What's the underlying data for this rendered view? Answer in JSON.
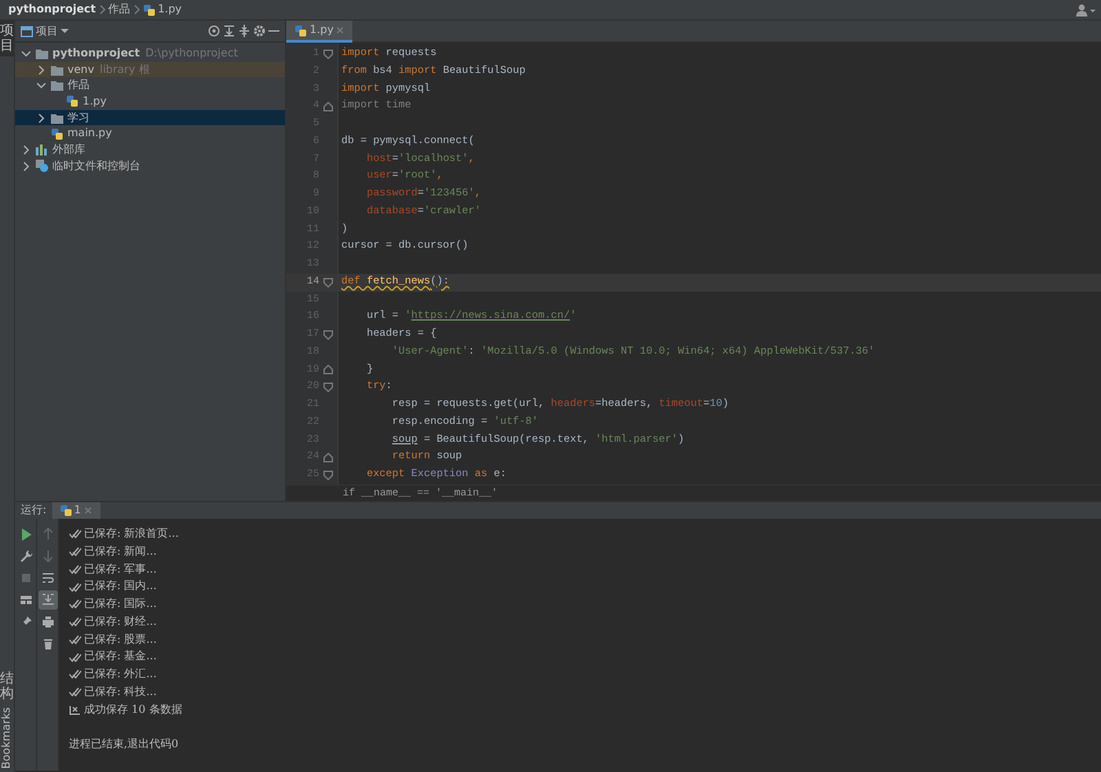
{
  "breadcrumb": [
    {
      "label": "pythonproject",
      "kind": "project"
    },
    {
      "label": "作品",
      "kind": "folder"
    },
    {
      "label": "1.py",
      "kind": "file"
    }
  ],
  "left_stripe": {
    "top_tabs": [
      {
        "label": "项目",
        "selected": true
      }
    ],
    "bottom_tabs": [
      {
        "label": "结构",
        "kind": "cjk"
      },
      {
        "label": "Bookmarks",
        "kind": "latin"
      }
    ]
  },
  "project_panel": {
    "title": "项目",
    "tree": [
      {
        "label": "pythonproject",
        "note": "D:\\pythonproject",
        "kind": "project",
        "expanded": true,
        "selected": false,
        "highlighted": false,
        "children": [
          {
            "label": "venv",
            "note": "library 根",
            "kind": "folder",
            "expanded": false,
            "selected": false,
            "highlighted": true
          },
          {
            "label": "作品",
            "kind": "folder",
            "expanded": true,
            "selected": false,
            "highlighted": false,
            "children": [
              {
                "label": "1.py",
                "kind": "file",
                "selected": false,
                "highlighted": false
              }
            ]
          },
          {
            "label": "学习",
            "kind": "folder",
            "expanded": false,
            "selected": true,
            "highlighted": false
          },
          {
            "label": "main.py",
            "kind": "file",
            "selected": false,
            "highlighted": false
          }
        ]
      },
      {
        "label": "外部库",
        "kind": "library",
        "expanded": false,
        "selected": false,
        "highlighted": false
      },
      {
        "label": "临时文件和控制台",
        "kind": "scratch",
        "expanded": false,
        "selected": false,
        "highlighted": false
      }
    ]
  },
  "editor": {
    "tabs": [
      {
        "label": "1.py",
        "selected": true
      }
    ],
    "lines": [
      {
        "number": "1",
        "fold_start": true,
        "fold_end": false,
        "current": false,
        "warning": false,
        "tokens": [
          {
            "text": "import",
            "kind": "kw"
          },
          {
            "text": " requests",
            "kind": "id"
          }
        ]
      },
      {
        "number": "2",
        "fold_start": false,
        "fold_end": false,
        "current": false,
        "warning": false,
        "tokens": [
          {
            "text": "from",
            "kind": "kw"
          },
          {
            "text": " bs4 ",
            "kind": "id"
          },
          {
            "text": "import",
            "kind": "kw"
          },
          {
            "text": " BeautifulSoup",
            "kind": "id"
          }
        ]
      },
      {
        "number": "3",
        "fold_start": false,
        "fold_end": false,
        "current": false,
        "warning": false,
        "tokens": [
          {
            "text": "import",
            "kind": "kw"
          },
          {
            "text": " pymysql",
            "kind": "id"
          }
        ]
      },
      {
        "number": "4",
        "fold_start": false,
        "fold_end": true,
        "current": false,
        "warning": false,
        "tokens": [
          {
            "text": "import time",
            "kind": "unused"
          }
        ]
      },
      {
        "number": "5",
        "fold_start": false,
        "fold_end": false,
        "current": false
      },
      {
        "number": "6",
        "fold_start": false,
        "fold_end": false,
        "current": false,
        "warning": false,
        "tokens": [
          {
            "text": "db = pymysql.connect(",
            "kind": "id"
          }
        ]
      },
      {
        "number": "7",
        "fold_start": false,
        "fold_end": false,
        "current": false,
        "warning": false,
        "tokens": [
          {
            "text": "    host",
            "kind": "param"
          },
          {
            "text": "=",
            "kind": "id"
          },
          {
            "text": "'localhost'",
            "kind": "str"
          },
          {
            "text": ",",
            "kind": "kw"
          }
        ]
      },
      {
        "number": "8",
        "fold_start": false,
        "fold_end": false,
        "current": false,
        "warning": false,
        "tokens": [
          {
            "text": "    user",
            "kind": "param"
          },
          {
            "text": "=",
            "kind": "id"
          },
          {
            "text": "'root'",
            "kind": "str"
          },
          {
            "text": ",",
            "kind": "kw"
          }
        ]
      },
      {
        "number": "9",
        "fold_start": false,
        "fold_end": false,
        "current": false,
        "warning": false,
        "tokens": [
          {
            "text": "    password",
            "kind": "param"
          },
          {
            "text": "=",
            "kind": "id"
          },
          {
            "text": "'123456'",
            "kind": "str"
          },
          {
            "text": ",",
            "kind": "kw"
          }
        ]
      },
      {
        "number": "10",
        "fold_start": false,
        "fold_end": false,
        "current": false,
        "warning": false,
        "tokens": [
          {
            "text": "    database",
            "kind": "param"
          },
          {
            "text": "=",
            "kind": "id"
          },
          {
            "text": "'crawler'",
            "kind": "str"
          }
        ]
      },
      {
        "number": "11",
        "fold_start": false,
        "fold_end": false,
        "current": false,
        "warning": false,
        "tokens": [
          {
            "text": ")",
            "kind": "id"
          }
        ]
      },
      {
        "number": "12",
        "fold_start": false,
        "fold_end": false,
        "current": false,
        "warning": false,
        "tokens": [
          {
            "text": "cursor = db.cursor()",
            "kind": "id"
          }
        ]
      },
      {
        "number": "13",
        "fold_start": false,
        "fold_end": false,
        "current": false
      },
      {
        "number": "14",
        "fold_start": true,
        "fold_end": false,
        "current": true,
        "warning": true,
        "tokens": [
          {
            "text": "def",
            "kind": "kw"
          },
          {
            "text": " fetch_news",
            "kind": "fn"
          },
          {
            "text": "():",
            "kind": "id"
          }
        ]
      },
      {
        "number": "15",
        "fold_start": false,
        "fold_end": false,
        "current": false
      },
      {
        "number": "16",
        "fold_start": false,
        "fold_end": false,
        "current": false,
        "warning": false,
        "tokens": [
          {
            "text": "    url = ",
            "kind": "id"
          },
          {
            "text": "'",
            "kind": "str"
          },
          {
            "text": "https://news.sina.com.cn/",
            "kind": "link"
          },
          {
            "text": "'",
            "kind": "str"
          }
        ]
      },
      {
        "number": "17",
        "fold_start": true,
        "fold_end": false,
        "current": false,
        "warning": false,
        "tokens": [
          {
            "text": "    headers = {",
            "kind": "id"
          }
        ]
      },
      {
        "number": "18",
        "fold_start": false,
        "fold_end": false,
        "current": false,
        "warning": false,
        "tokens": [
          {
            "text": "        'User-Agent'",
            "kind": "str"
          },
          {
            "text": ": ",
            "kind": "id"
          },
          {
            "text": "'Mozilla/5.0 (Windows NT 10.0; Win64; x64) AppleWebKit/537.36'",
            "kind": "str"
          }
        ]
      },
      {
        "number": "19",
        "fold_start": false,
        "fold_end": true,
        "current": false,
        "warning": false,
        "tokens": [
          {
            "text": "    }",
            "kind": "id"
          }
        ]
      },
      {
        "number": "20",
        "fold_start": true,
        "fold_end": false,
        "current": false,
        "warning": false,
        "tokens": [
          {
            "text": "    try",
            "kind": "kw"
          },
          {
            "text": ":",
            "kind": "id"
          }
        ]
      },
      {
        "number": "21",
        "fold_start": false,
        "fold_end": false,
        "current": false,
        "warning": false,
        "tokens": [
          {
            "text": "        resp = requests.get(url, ",
            "kind": "id"
          },
          {
            "text": "headers",
            "kind": "param"
          },
          {
            "text": "=headers, ",
            "kind": "id"
          },
          {
            "text": "timeout",
            "kind": "param"
          },
          {
            "text": "=",
            "kind": "id"
          },
          {
            "text": "10",
            "kind": "num"
          },
          {
            "text": ")",
            "kind": "id"
          }
        ]
      },
      {
        "number": "22",
        "fold_start": false,
        "fold_end": false,
        "current": false,
        "warning": false,
        "tokens": [
          {
            "text": "        resp.encoding = ",
            "kind": "id"
          },
          {
            "text": "'utf-8'",
            "kind": "str"
          }
        ]
      },
      {
        "number": "23",
        "fold_start": false,
        "fold_end": false,
        "current": false,
        "warning": false,
        "tokens": [
          {
            "text": "        soup",
            "kind": "underlined"
          },
          {
            "text": " = BeautifulSoup(resp.text, ",
            "kind": "id"
          },
          {
            "text": "'html.parser'",
            "kind": "str"
          },
          {
            "text": ")",
            "kind": "id"
          }
        ]
      },
      {
        "number": "24",
        "fold_start": false,
        "fold_end": true,
        "current": false,
        "warning": false,
        "tokens": [
          {
            "text": "        return",
            "kind": "kw"
          },
          {
            "text": " soup",
            "kind": "id"
          }
        ]
      },
      {
        "number": "25",
        "fold_start": true,
        "fold_end": false,
        "current": false,
        "warning": false,
        "tokens": [
          {
            "text": "    except",
            "kind": "kw"
          },
          {
            "text": " Exception",
            "kind": "builtin"
          },
          {
            "text": " as",
            "kind": "kw"
          },
          {
            "text": " e:",
            "kind": "id"
          }
        ]
      }
    ],
    "scope_breadcrumb": "if __name__ == '__main__'"
  },
  "run_panel": {
    "title": "运行:",
    "tabs": [
      {
        "label": "1",
        "selected": true
      }
    ],
    "run_toolbar": [
      {
        "kind": "play",
        "disabled": false
      },
      {
        "kind": "wrench",
        "disabled": false
      },
      {
        "kind": "stop",
        "disabled": true
      },
      {
        "kind": "layout",
        "disabled": false
      },
      {
        "kind": "pin",
        "disabled": false
      }
    ],
    "console_toolbar": [
      {
        "kind": "up",
        "disabled": true,
        "selected": false
      },
      {
        "kind": "down",
        "disabled": true,
        "selected": false
      },
      {
        "kind": "wrap",
        "disabled": false,
        "selected": false
      },
      {
        "kind": "scroll-end",
        "disabled": false,
        "selected": true
      },
      {
        "kind": "print",
        "disabled": false,
        "selected": false
      },
      {
        "kind": "trash",
        "disabled": false,
        "selected": false
      }
    ],
    "lines": [
      {
        "kind": "saved",
        "text": "已保存: 新浪首页..."
      },
      {
        "kind": "saved",
        "text": "已保存: 新闻..."
      },
      {
        "kind": "saved",
        "text": "已保存: 军事..."
      },
      {
        "kind": "saved",
        "text": "已保存: 国内..."
      },
      {
        "kind": "saved",
        "text": "已保存: 国际..."
      },
      {
        "kind": "saved",
        "text": "已保存: 财经..."
      },
      {
        "kind": "saved",
        "text": "已保存: 股票..."
      },
      {
        "kind": "saved",
        "text": "已保存: 基金..."
      },
      {
        "kind": "saved",
        "text": "已保存: 外汇..."
      },
      {
        "kind": "saved",
        "text": "已保存: 科技..."
      },
      {
        "kind": "summary",
        "text": "成功保存 10 条数据"
      },
      {
        "kind": "exit",
        "text": "进程已结束,退出代码0"
      }
    ]
  }
}
